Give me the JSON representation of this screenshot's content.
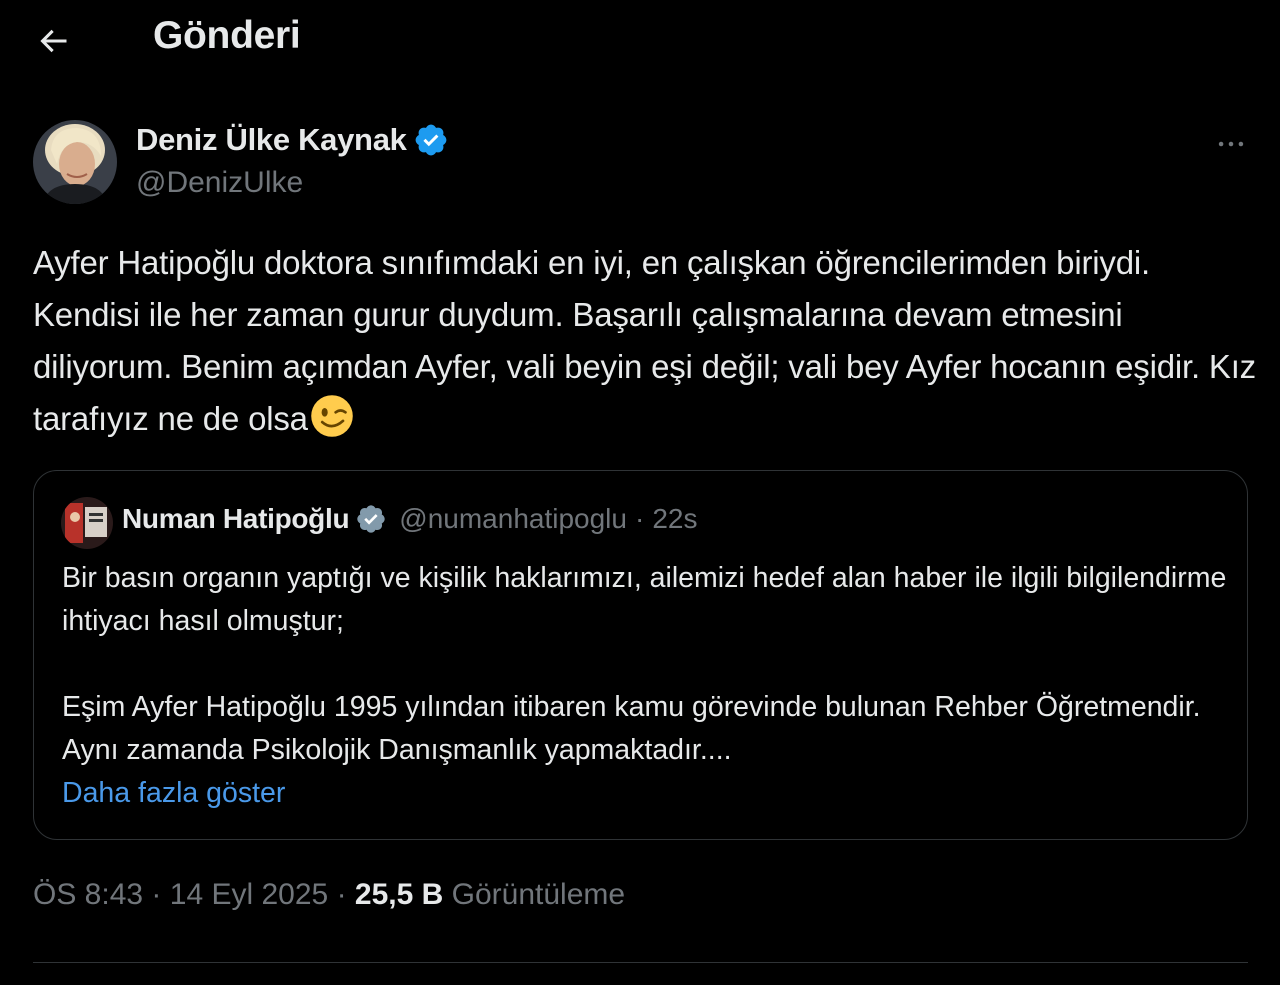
{
  "header": {
    "title": "Gönderi"
  },
  "tweet": {
    "display_name": "Deniz Ülke Kaynak",
    "handle": "@DenizUlke",
    "text": "Ayfer Hatipoğlu doktora sınıfımdaki en iyi, en çalışkan öğrencilerimden biriydi. Kendisi ile her zaman gurur duydum. Başarılı çalışmalarına devam etmesini diliyorum. Benim açımdan Ayfer, vali beyin eşi değil; vali bey Ayfer hocanın eşidir. Kız tarafıyız ne de olsa",
    "emoji": "winking-face"
  },
  "quote": {
    "display_name": "Numan Hatipoğlu",
    "handle": "@numanhatipoglu",
    "separator": "·",
    "time": "22s",
    "paragraph1": "Bir basın organın yaptığı ve kişilik haklarımızı, ailemizi hedef alan haber ile ilgili bilgilendirme ihtiyacı hasıl olmuştur;",
    "paragraph2": "Eşim Ayfer Hatipoğlu 1995 yılından itibaren kamu görevinde bulunan Rehber Öğretmendir. Aynı zamanda Psikolojik Danışmanlık yapmaktadır....",
    "show_more": "Daha fazla göster"
  },
  "meta": {
    "time": "ÖS 8:43",
    "sep1": "·",
    "date": "14 Eyl 2025",
    "sep2": "·",
    "views_count": "25,5 B",
    "views_label": "Görüntüleme"
  },
  "colors": {
    "background": "#000000",
    "text": "#e7e9ea",
    "secondary": "#71767b",
    "verified": "#1d9bf0",
    "link": "#4a99e9",
    "border": "#2f3336"
  }
}
